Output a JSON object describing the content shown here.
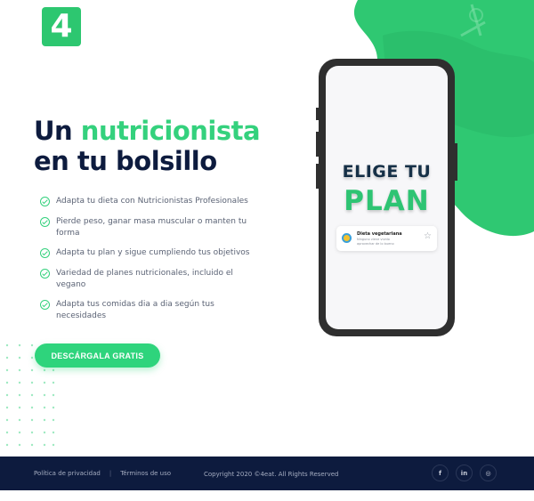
{
  "logo": {
    "text": "4"
  },
  "hero": {
    "line1_plain": "Un ",
    "line1_accent": "nutricionista",
    "line2": "en tu bolsillo"
  },
  "features": [
    "Adapta tu dieta con Nutricionistas Profesionales",
    "Pierde peso, ganar masa muscular o manten tu forma",
    "Adapta tu plan y sigue cumpliendo tus objetivos",
    "Variedad de planes nutricionales, incluido el vegano",
    "Adapta tus comidas dia a dia según tus necesidades"
  ],
  "cta": {
    "label": "DESCÁRGALA GRATIS"
  },
  "phone": {
    "title1": "ELIGE TU",
    "title2": "PLAN",
    "card": {
      "title": "Dieta vegetariana",
      "subtitle": "Ninguno viene vivido aprovechar de lo bueno",
      "star": "☆"
    }
  },
  "footer": {
    "privacy": "Política de privacidad",
    "terms": "Términos de uso",
    "copyright": "Copyright 2020 ©4eat. All Rights Reserved",
    "social": [
      {
        "label": "f",
        "icon": "facebook-icon"
      },
      {
        "label": "in",
        "icon": "linkedin-icon"
      },
      {
        "label": "◎",
        "icon": "instagram-icon"
      }
    ]
  },
  "colors": {
    "accent": "#2ed47c",
    "navy": "#0d1b3e"
  }
}
